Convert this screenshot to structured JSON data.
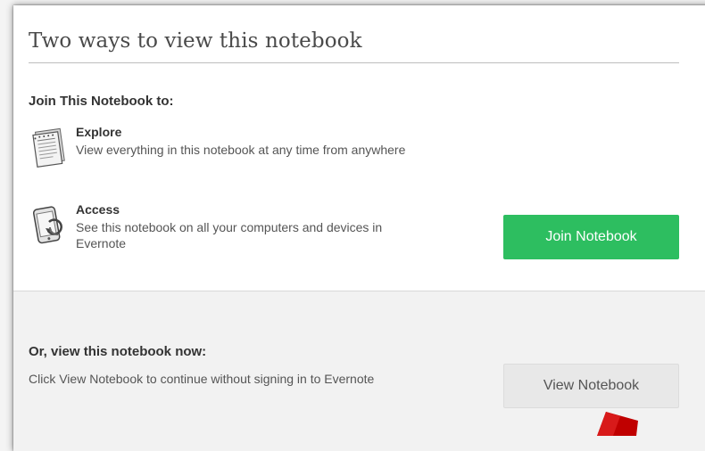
{
  "dialog": {
    "title": "Two ways to view this notebook",
    "join_section": {
      "heading": "Join This Notebook to:",
      "features": [
        {
          "icon": "notebook-pages-icon",
          "title": "Explore",
          "description": "View everything in this notebook at any time from anywhere"
        },
        {
          "icon": "device-sync-icon",
          "title": "Access",
          "description": "See this notebook on all your computers and devices in Evernote"
        }
      ],
      "join_button_label": "Join Notebook"
    },
    "view_section": {
      "heading": "Or, view this notebook now:",
      "description": "Click View Notebook to continue without signing in to Evernote",
      "view_button_label": "View Notebook"
    }
  },
  "colors": {
    "join_button": "#2dbe60",
    "view_button": "#e8e8e8",
    "arrow": "#c00000"
  }
}
